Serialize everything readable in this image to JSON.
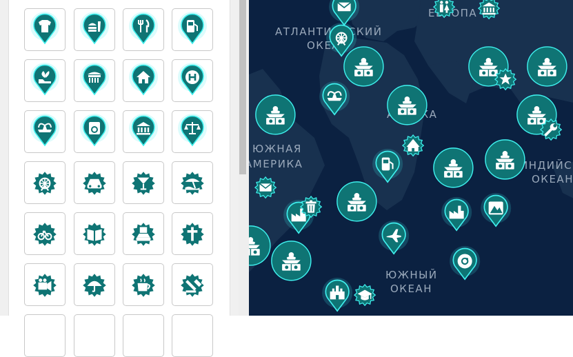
{
  "theme": {
    "teal": "#0f7474",
    "glow": "#3ff0ee",
    "map_bg": "#0b2141",
    "land": "#18314f"
  },
  "icon_gallery": [
    {
      "type": "pin",
      "icon": "tshirt-icon"
    },
    {
      "type": "pin",
      "icon": "fast-food-icon"
    },
    {
      "type": "pin",
      "icon": "restaurant-icon"
    },
    {
      "type": "pin",
      "icon": "fuel-station-icon"
    },
    {
      "type": "pin",
      "icon": "garden-icon"
    },
    {
      "type": "pin",
      "icon": "market-icon"
    },
    {
      "type": "pin",
      "icon": "home-icon"
    },
    {
      "type": "pin",
      "icon": "hospital-icon"
    },
    {
      "type": "pin",
      "icon": "fountain-icon"
    },
    {
      "type": "pin",
      "icon": "laundry-icon"
    },
    {
      "type": "pin",
      "icon": "museum-icon"
    },
    {
      "type": "pin",
      "icon": "court-icon"
    },
    {
      "type": "badge",
      "icon": "ferris-wheel-icon"
    },
    {
      "type": "badge",
      "icon": "car-icon"
    },
    {
      "type": "badge",
      "icon": "cocktail-icon"
    },
    {
      "type": "badge",
      "icon": "beach-icon"
    },
    {
      "type": "badge",
      "icon": "bicycle-icon"
    },
    {
      "type": "badge",
      "icon": "library-icon"
    },
    {
      "type": "badge",
      "icon": "car-rental-icon"
    },
    {
      "type": "badge",
      "icon": "church-icon"
    },
    {
      "type": "badge",
      "icon": "cinema-icon"
    },
    {
      "type": "badge",
      "icon": "umbrella-icon"
    },
    {
      "type": "badge",
      "icon": "coffee-icon"
    },
    {
      "type": "badge",
      "icon": "justice-icon"
    }
  ],
  "map_labels": {
    "atlantic_line1": "АТЛАНТИЧЕСКИЙ",
    "atlantic_line2": "ОКЕАН",
    "europe": "ЕВРОПА",
    "africa": "АФРИКА",
    "south_america_line1": "ЮЖНАЯ",
    "south_america_line2": "АМЕРИКА",
    "indian_line1": "ИНДИЙСКИЙ",
    "indian_line2": "ОКЕАН",
    "southern_line1": "ЮЖНЫЙ",
    "southern_line2": "ОКЕАН"
  },
  "map_markers": [
    {
      "type": "pin",
      "icon": "mail-icon"
    },
    {
      "type": "pin",
      "icon": "ferris-wheel-icon"
    },
    {
      "type": "badge",
      "icon": "toilets-icon"
    },
    {
      "type": "badge",
      "icon": "museum-icon"
    },
    {
      "type": "circle",
      "icon": "dj-icon"
    },
    {
      "type": "circle",
      "icon": "dj-icon"
    },
    {
      "type": "circle",
      "icon": "dj-icon"
    },
    {
      "type": "badge",
      "icon": "star-icon"
    },
    {
      "type": "pin",
      "icon": "fountain-icon"
    },
    {
      "type": "circle",
      "icon": "dj-icon"
    },
    {
      "type": "circle",
      "icon": "dj-icon"
    },
    {
      "type": "circle",
      "icon": "dj-icon"
    },
    {
      "type": "badge",
      "icon": "circus-icon"
    },
    {
      "type": "pin",
      "icon": "fuel-station-icon"
    },
    {
      "type": "circle",
      "icon": "dj-icon"
    },
    {
      "type": "circle",
      "icon": "dj-icon"
    },
    {
      "type": "circle",
      "icon": "dj-icon"
    },
    {
      "type": "badge",
      "icon": "mail-icon"
    },
    {
      "type": "circle",
      "icon": "dj-icon"
    },
    {
      "type": "pin",
      "icon": "factory-icon"
    },
    {
      "type": "badge",
      "icon": "trash-icon"
    },
    {
      "type": "pin",
      "icon": "factory-icon"
    },
    {
      "type": "pin",
      "icon": "mountain-icon"
    },
    {
      "type": "circle",
      "icon": "dj-icon"
    },
    {
      "type": "pin",
      "icon": "airport-icon"
    },
    {
      "type": "pin",
      "icon": "music-icon"
    },
    {
      "type": "pin",
      "icon": "castle-icon"
    },
    {
      "type": "badge",
      "icon": "graduation-cap-icon"
    },
    {
      "type": "badge",
      "icon": "wrench-icon"
    }
  ]
}
